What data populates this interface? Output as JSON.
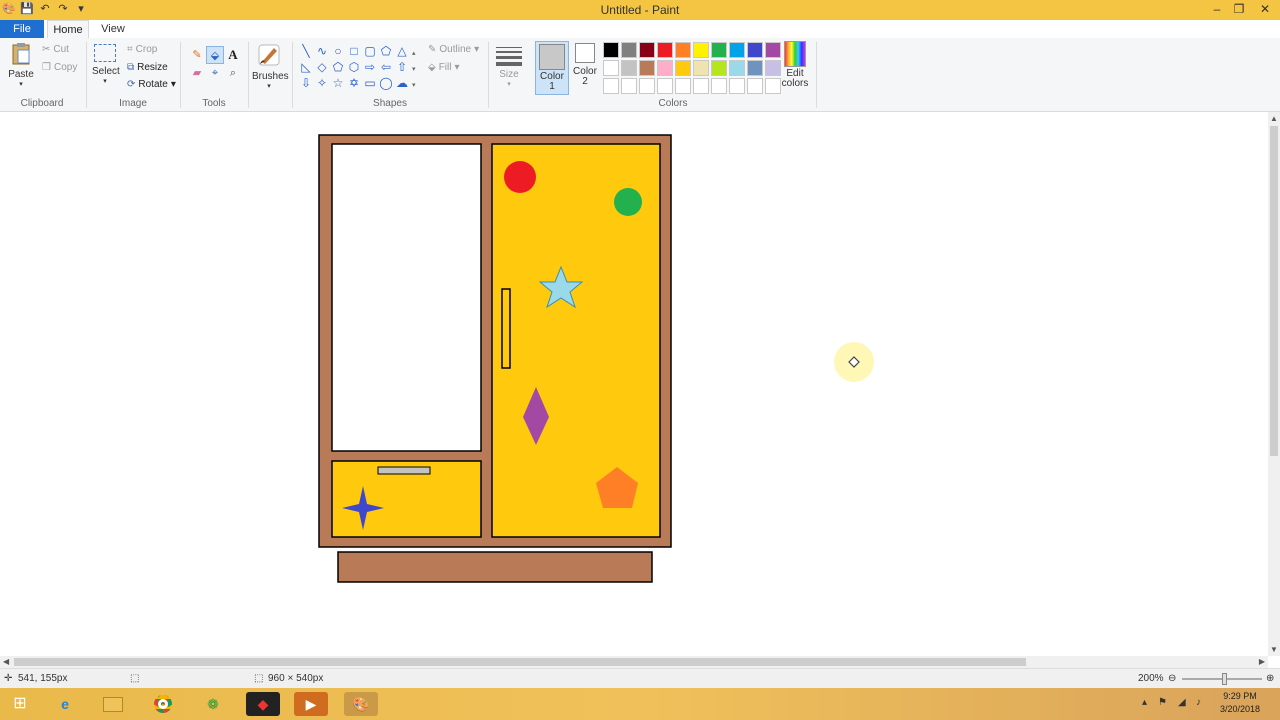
{
  "window": {
    "title": "Untitled - Paint"
  },
  "tabs": {
    "file": "File",
    "home": "Home",
    "view": "View"
  },
  "clipboard": {
    "paste": "Paste",
    "cut": "Cut",
    "copy": "Copy",
    "label": "Clipboard"
  },
  "image": {
    "select": "Select",
    "crop": "Crop",
    "resize": "Resize",
    "rotate": "Rotate",
    "label": "Image"
  },
  "tools": {
    "label": "Tools",
    "text_tool": "A"
  },
  "brushes": {
    "label": "Brushes"
  },
  "shapes": {
    "outline": "Outline",
    "fill": "Fill",
    "label": "Shapes"
  },
  "size": {
    "label": "Size"
  },
  "colors": {
    "color1_label": "Color\n1",
    "color2_label": "Color\n2",
    "edit_label": "Edit\ncolors",
    "label": "Colors",
    "color1": "#c8c8c8",
    "color2": "#ffffff",
    "palette_row1": [
      "#000000",
      "#7f7f7f",
      "#880015",
      "#ed1c24",
      "#ff7f27",
      "#fff200",
      "#22b14c",
      "#00a2e8",
      "#3f48cc",
      "#a349a4"
    ],
    "palette_row2": [
      "#ffffff",
      "#c3c3c3",
      "#b97a57",
      "#ffaec9",
      "#ffc90e",
      "#efe4b0",
      "#b5e61d",
      "#99d9ea",
      "#7092be",
      "#c8bfe7"
    ],
    "palette_row3": [
      "#ffffff",
      "#ffffff",
      "#ffffff",
      "#ffffff",
      "#ffffff",
      "#ffffff",
      "#ffffff",
      "#ffffff",
      "#ffffff",
      "#ffffff"
    ]
  },
  "drawing": {
    "cabinet_color": "#b97a57",
    "panel_color": "#ffc90e",
    "shape_colors": {
      "red_circle": "#ed1c24",
      "green_circle": "#22b14c",
      "star": "#99d9ea",
      "diamond": "#a349a4",
      "pentagon": "#ff7f27",
      "four_star": "#3f48cc"
    }
  },
  "status": {
    "cursor_pos": "541, 155px",
    "canvas_size": "960 × 540px",
    "zoom": "200%"
  },
  "taskbar": {
    "time": "9:29 PM",
    "date": "3/20/2018"
  }
}
